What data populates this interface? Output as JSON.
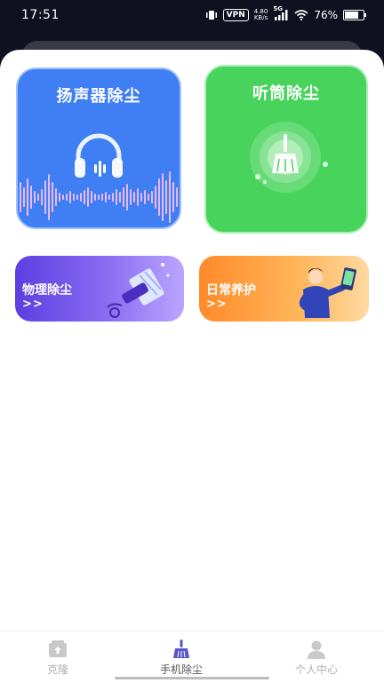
{
  "status_bar": {
    "time": "17:51",
    "vpn": "VPN",
    "net_speed_value": "4.80",
    "net_speed_unit": "KB/s",
    "signal_label": "5G",
    "battery_text": "76%",
    "battery_level": 0.76
  },
  "cards": {
    "speaker": {
      "title": "扬声器除尘",
      "color": "#3f7ef3"
    },
    "receiver": {
      "title": "听筒除尘",
      "color": "#47d35c"
    },
    "physical": {
      "title": "物理除尘",
      "arrow": ">>"
    },
    "daily": {
      "title": "日常养护",
      "arrow": ">>"
    }
  },
  "tabbar": {
    "tabs": [
      {
        "label": "克隆",
        "icon": "clone-icon",
        "active": false
      },
      {
        "label": "手机除尘",
        "icon": "broom-icon",
        "active": true
      },
      {
        "label": "个人中心",
        "icon": "person-icon",
        "active": false
      }
    ]
  }
}
